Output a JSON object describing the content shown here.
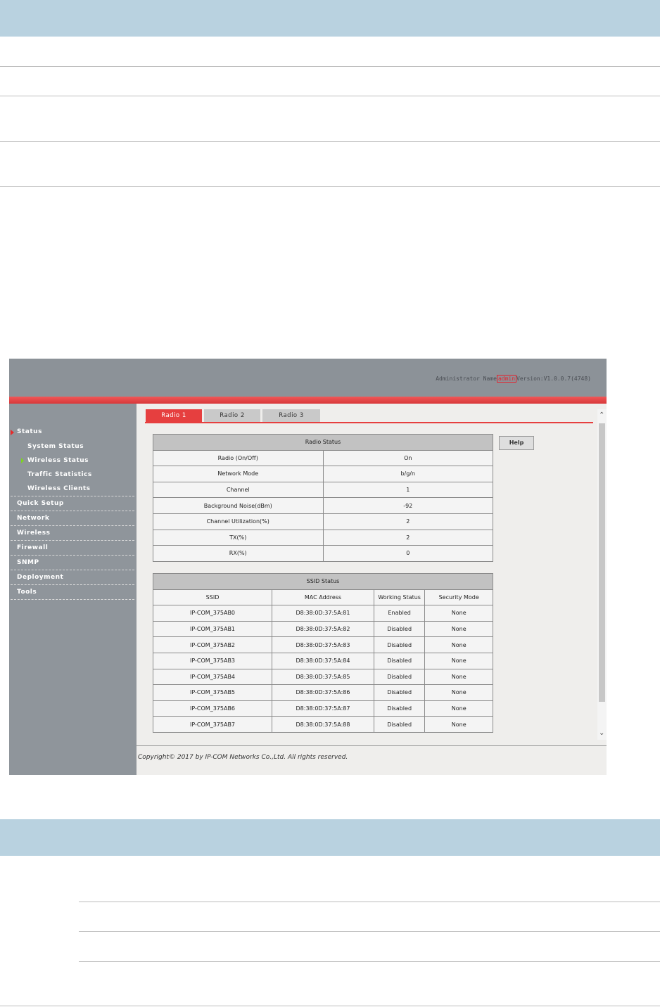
{
  "header": {
    "admin_label": "Administrator Name",
    "admin_user": "admin",
    "version": "Version:V1.0.0.7(4748)"
  },
  "sidebar": {
    "status": "Status",
    "system_status": "System Status",
    "wireless_status": "Wireless Status",
    "traffic_statistics": "Traffic Statistics",
    "wireless_clients": "Wireless Clients",
    "quick_setup": "Quick Setup",
    "network": "Network",
    "wireless": "Wireless",
    "firewall": "Firewall",
    "snmp": "SNMP",
    "deployment": "Deployment",
    "tools": "Tools"
  },
  "tabs": [
    "Radio 1",
    "Radio 2",
    "Radio 3"
  ],
  "help_label": "Help",
  "radio_status": {
    "caption": "Radio Status",
    "rows": [
      [
        "Radio (On/Off)",
        "On"
      ],
      [
        "Network Mode",
        "b/g/n"
      ],
      [
        "Channel",
        "1"
      ],
      [
        "Background Noise(dBm)",
        "-92"
      ],
      [
        "Channel Utilization(%)",
        "2"
      ],
      [
        "TX(%)",
        "2"
      ],
      [
        "RX(%)",
        "0"
      ]
    ]
  },
  "ssid_status": {
    "caption": "SSID Status",
    "headers": [
      "SSID",
      "MAC Address",
      "Working Status",
      "Security Mode"
    ],
    "rows": [
      [
        "IP-COM_375AB0",
        "D8:38:0D:37:5A:81",
        "Enabled",
        "None"
      ],
      [
        "IP-COM_375AB1",
        "D8:38:0D:37:5A:82",
        "Disabled",
        "None"
      ],
      [
        "IP-COM_375AB2",
        "D8:38:0D:37:5A:83",
        "Disabled",
        "None"
      ],
      [
        "IP-COM_375AB3",
        "D8:38:0D:37:5A:84",
        "Disabled",
        "None"
      ],
      [
        "IP-COM_375AB4",
        "D8:38:0D:37:5A:85",
        "Disabled",
        "None"
      ],
      [
        "IP-COM_375AB5",
        "D8:38:0D:37:5A:86",
        "Disabled",
        "None"
      ],
      [
        "IP-COM_375AB6",
        "D8:38:0D:37:5A:87",
        "Disabled",
        "None"
      ],
      [
        "IP-COM_375AB7",
        "D8:38:0D:37:5A:88",
        "Disabled",
        "None"
      ]
    ]
  },
  "footer": {
    "copyright": "Copyright© 2017 by IP-COM Networks Co.,Ltd. All rights reserved."
  },
  "colors": {
    "accent_red": "#e63f3f",
    "sidebar_gray": "#8f959b",
    "band_blue": "#b9d2e0"
  }
}
